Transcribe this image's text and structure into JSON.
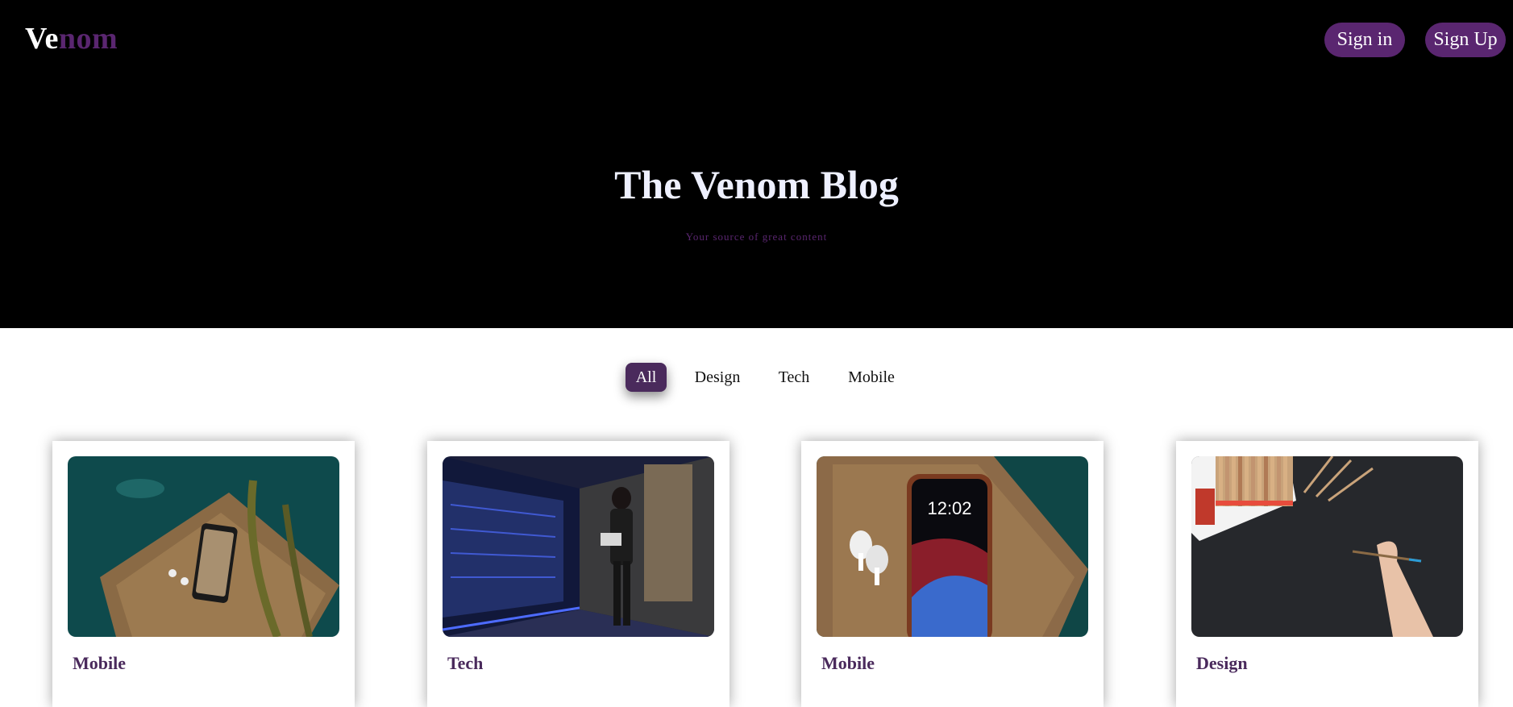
{
  "header": {
    "logo_part1": "Ve",
    "logo_part2": "nom",
    "sign_in": "Sign in",
    "sign_up": "Sign Up"
  },
  "hero": {
    "title": "The Venom Blog",
    "subtitle": "Your source of great content"
  },
  "filters": {
    "items": [
      "All",
      "Design",
      "Tech",
      "Mobile"
    ],
    "active": "All"
  },
  "cards": [
    {
      "category": "Mobile",
      "image": "phone-on-wooden-deck-photo"
    },
    {
      "category": "Tech",
      "image": "woman-in-server-room-photo"
    },
    {
      "category": "Mobile",
      "image": "smartphone-and-earbuds-photo"
    },
    {
      "category": "Design",
      "image": "hand-drawing-with-pencils-photo"
    }
  ],
  "colors": {
    "brand": "#5a2670",
    "filter_active": "#4a2a5c",
    "hero_bg": "#000000"
  }
}
